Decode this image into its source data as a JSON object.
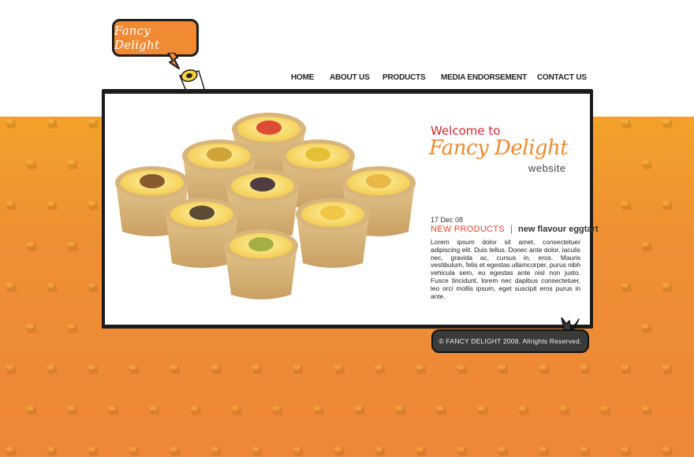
{
  "logo": {
    "text": "Fancy Delight",
    "icon": "tart-icon"
  },
  "nav": {
    "items": [
      {
        "label": "HOME"
      },
      {
        "label": "ABOUT US"
      },
      {
        "label": "PRODUCTS"
      },
      {
        "label": "MEDIA ENDORSEMENT"
      },
      {
        "label": "CONTACT US"
      }
    ]
  },
  "hero": {
    "image": "assorted-fruit-egg-tarts-photo"
  },
  "welcome": {
    "line1": "Welcome to",
    "brand": "Fancy Delight",
    "sub": "website"
  },
  "news": {
    "date": "17 Dec 08",
    "category": "NEW PRODUCTS",
    "separator": "|",
    "title": "new flavour eggtart",
    "body": "Lorem ipsum dolor sit amet, consectetuer adipiscing elit. Duis tellus. Donec ante dolor, iaculis nec, gravida ac, cursus in, eros. Mauris vestibulum, felis et egestas ullamcorper, purus nibh vehicula sem, eu egestas ante nisl non justo. Fusce tincidunt, lorem nec dapibus consectetuer, leo orci mollis ipsum, eget suscipit eros purus in ante."
  },
  "footer": {
    "copyright": "© FANCY DELIGHT 2008. Allrights Reserved."
  },
  "colors": {
    "brand_orange": "#ef8a2f",
    "welcome_red": "#d9272e",
    "background_orange": "#ee8737",
    "panel_border": "#1b1b1b"
  }
}
